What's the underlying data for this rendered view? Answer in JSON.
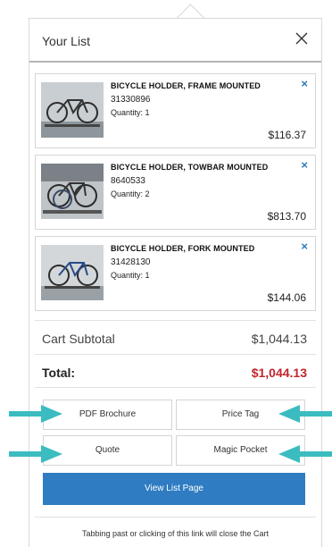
{
  "header": {
    "title": "Your List"
  },
  "items": [
    {
      "name": "BICYCLE HOLDER, FRAME MOUNTED",
      "sku": "31330896",
      "quantity": "Quantity: 1",
      "price": "$116.37",
      "remove": "×"
    },
    {
      "name": "BICYCLE HOLDER, TOWBAR MOUNTED",
      "sku": "8640533",
      "quantity": "Quantity: 2",
      "price": "$813.70",
      "remove": "×"
    },
    {
      "name": "BICYCLE HOLDER, FORK MOUNTED",
      "sku": "31428130",
      "quantity": "Quantity: 1",
      "price": "$144.06",
      "remove": "×"
    }
  ],
  "summary": {
    "subtotal_label": "Cart Subtotal",
    "subtotal_value": "$1,044.13",
    "total_label": "Total:",
    "total_value": "$1,044.13"
  },
  "actions": {
    "pdf_brochure": "PDF Brochure",
    "price_tag": "Price Tag",
    "quote": "Quote",
    "magic_pocket": "Magic Pocket",
    "view_list": "View List Page"
  },
  "footer": {
    "note": "Tabbing past or clicking of this link will close the Cart"
  },
  "colors": {
    "accent": "#2f7cc2",
    "total": "#c1262e",
    "annotation_arrow": "#3bbcc0",
    "remove_icon": "#2a7bbd"
  },
  "icons": {
    "close": "close-icon",
    "remove": "remove-icon",
    "annotation": "arrow-icon"
  }
}
